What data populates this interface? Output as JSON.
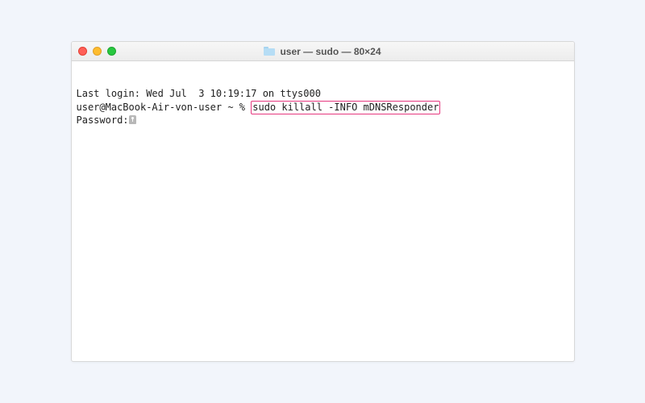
{
  "window": {
    "title": "user — sudo — 80×24",
    "traffic": {
      "close": "close-window",
      "minimize": "minimize-window",
      "zoom": "zoom-window"
    }
  },
  "terminal": {
    "last_login": "Last login: Wed Jul  3 10:19:17 on ttys000",
    "prompt": "user@MacBook-Air-von-user ~ % ",
    "command": "sudo killall -INFO mDNSResponder",
    "password_label": "Password:"
  }
}
